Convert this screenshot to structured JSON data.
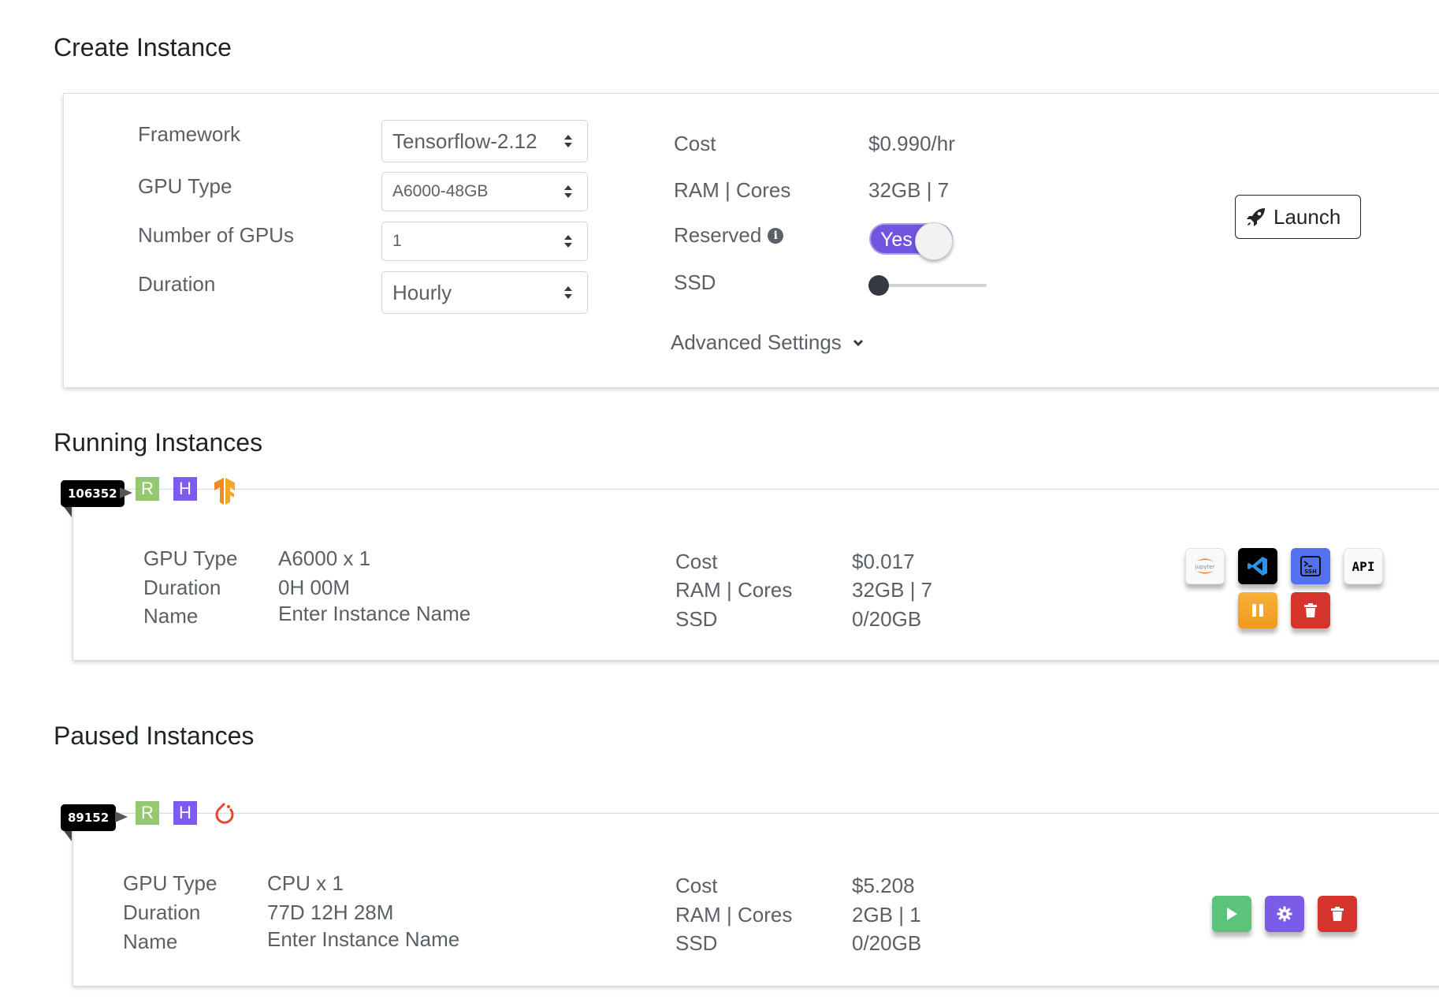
{
  "create": {
    "title": "Create Instance",
    "framework_label": "Framework",
    "framework_value": "Tensorflow-2.12",
    "gpu_type_label": "GPU Type",
    "gpu_type_value": "A6000-48GB",
    "num_gpus_label": "Number of GPUs",
    "num_gpus_value": "1",
    "duration_label": "Duration",
    "duration_value": "Hourly",
    "cost_label": "Cost",
    "cost_value": "$0.990/hr",
    "ram_label": "RAM | Cores",
    "ram_value": "32GB | 7",
    "reserved_label": "Reserved",
    "reserved_toggle": "Yes",
    "ssd_label": "SSD",
    "ssd_level": 0,
    "advanced_label": "Advanced Settings",
    "launch_label": "Launch"
  },
  "running": {
    "title": "Running Instances",
    "id": "106352",
    "badge_r": "R",
    "badge_h": "H",
    "gpu_type_label": "GPU Type",
    "gpu_type_value": "A6000 x 1",
    "duration_label": "Duration",
    "duration_value": "0H 00M",
    "name_label": "Name",
    "name_value": "Enter Instance Name",
    "cost_label": "Cost",
    "cost_value": "$0.017",
    "ram_label": "RAM | Cores",
    "ram_value": "32GB | 7",
    "ssd_label": "SSD",
    "ssd_value": "0/20GB",
    "jupyter_text": "jupyter",
    "ssh_text": "SSH",
    "api_label": "API"
  },
  "paused": {
    "title": "Paused Instances",
    "id": "89152",
    "badge_r": "R",
    "badge_h": "H",
    "gpu_type_label": "GPU Type",
    "gpu_type_value": "CPU x 1",
    "duration_label": "Duration",
    "duration_value": "77D 12H 28M",
    "name_label": "Name",
    "name_value": "Enter Instance Name",
    "cost_label": "Cost",
    "cost_value": "$5.208",
    "ram_label": "RAM | Cores",
    "ram_value": "2GB | 1",
    "ssd_label": "SSD",
    "ssd_value": "0/20GB"
  },
  "colors": {
    "accent_purple": "#6f55e0",
    "badge_r": "#94c970",
    "badge_h": "#7d5bf0",
    "tensorflow_orange": "#f08a24",
    "pytorch_red": "#e5472b",
    "delete_red": "#d4342c",
    "pause_orange": "#f09a1e",
    "resume_green": "#5bc47a"
  },
  "icons": {
    "launch": "rocket-icon",
    "reserved_info": "info-icon",
    "advanced": "chevron-down-icon",
    "running_framework": "tensorflow-icon",
    "paused_framework": "pytorch-icon",
    "running_actions": [
      "jupyter-icon",
      "vscode-icon",
      "ssh-terminal-icon",
      "api-icon",
      "pause-icon",
      "trash-icon"
    ],
    "paused_actions": [
      "play-icon",
      "gear-icon",
      "trash-icon"
    ]
  }
}
